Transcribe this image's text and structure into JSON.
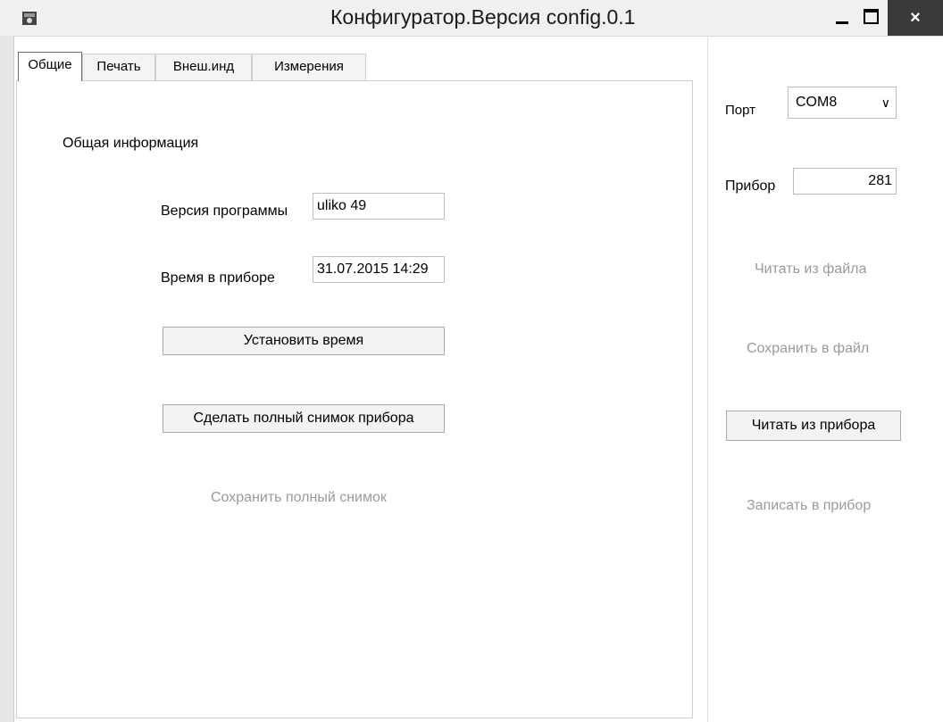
{
  "window": {
    "title": "Конфигуратор.Версия config.0.1",
    "controls": {
      "minimize": "minimize",
      "maximize": "maximize",
      "close": "×"
    }
  },
  "tabs": [
    {
      "label": "Общие",
      "active": true
    },
    {
      "label": "Печать",
      "active": false
    },
    {
      "label": "Внеш.инд",
      "active": false
    },
    {
      "label": "Измерения",
      "active": false
    }
  ],
  "general": {
    "section_title": "Общая информация",
    "program_version_label": "Версия программы",
    "program_version_value": "uliko 49",
    "device_time_label": "Время в приборе",
    "device_time_value": "31.07.2015 14:29",
    "set_time_button": "Установить время",
    "full_snapshot_button": "Сделать полный снимок прибора",
    "save_full_snapshot_link": "Сохранить полный снимок"
  },
  "right_panel": {
    "port_label": "Порт",
    "port_value": "COM8",
    "device_label": "Прибор",
    "device_value": "281",
    "read_from_file": "Читать из файла",
    "save_to_file": "Сохранить в файл",
    "read_from_device": "Читать из прибора",
    "write_to_device": "Записать в прибор"
  }
}
